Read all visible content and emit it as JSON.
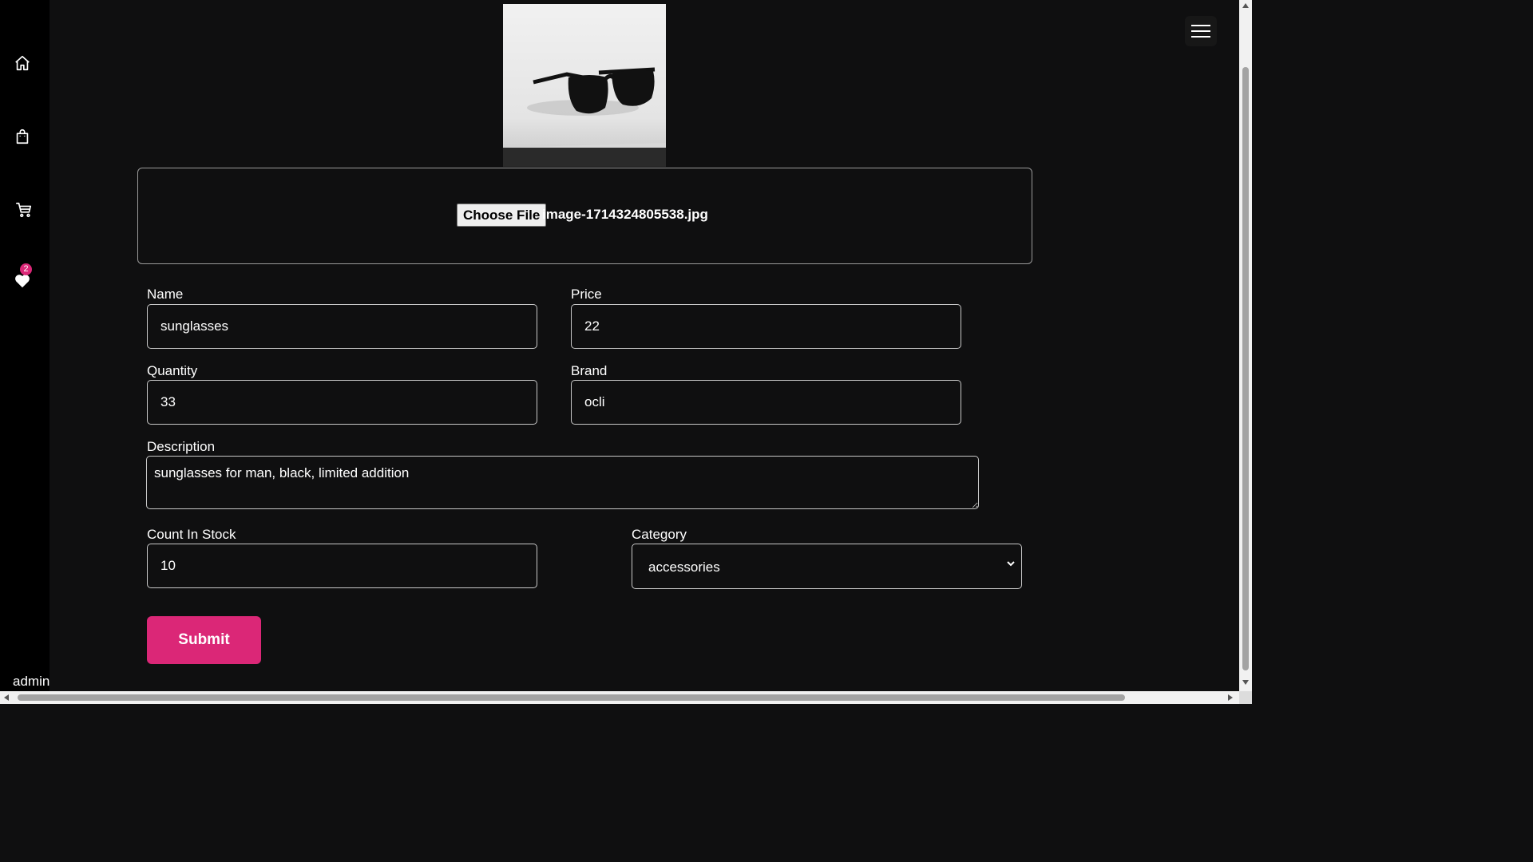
{
  "sidebar": {
    "items": [
      {
        "name": "home",
        "icon": "home-icon"
      },
      {
        "name": "shop",
        "icon": "shopping-bag-icon"
      },
      {
        "name": "cart",
        "icon": "cart-icon"
      },
      {
        "name": "favorites",
        "icon": "heart-icon"
      }
    ],
    "favorites_count": "2",
    "user_label": "admin"
  },
  "upload": {
    "choose_label": "Choose File",
    "file_name": "image-1714324805538.jpg"
  },
  "form": {
    "name_label": "Name",
    "name_value": "sunglasses",
    "price_label": "Price",
    "price_value": "22",
    "quantity_label": "Quantity",
    "quantity_value": "33",
    "brand_label": "Brand",
    "brand_value": "ocli",
    "description_label": "Description",
    "description_value": "sunglasses for man, black, limited addition",
    "stock_label": "Count In Stock",
    "stock_value": "10",
    "category_label": "Category",
    "category_value": "accessories",
    "submit_label": "Submit"
  },
  "colors": {
    "accent": "#db2777",
    "background": "#0f0f10",
    "sidebar": "#000000"
  }
}
